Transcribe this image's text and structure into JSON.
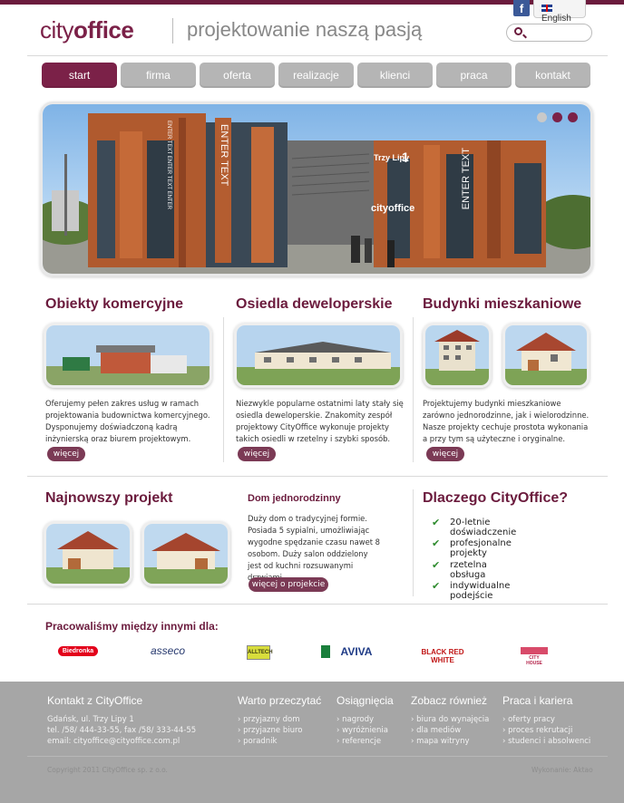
{
  "header": {
    "logo_a": "city",
    "logo_b": "office",
    "tagline": "projektowanie naszą pasją",
    "facebook_label": "f",
    "lang_label": "English",
    "search_placeholder": ""
  },
  "nav": [
    "start",
    "firma",
    "oferta",
    "realizacje",
    "klienci",
    "praca",
    "kontakt"
  ],
  "nav_active": "start",
  "hero": {
    "sign_trzy": "Trzy Lipy",
    "sign_num": "1",
    "sign_brand": "cityoffice",
    "banner_text": "ENTER TEXT",
    "banner_text_small": "ENTER TEXT ENTER TEXT ENTER"
  },
  "columns": [
    {
      "title": "Obiekty komercyjne",
      "text": "Oferujemy pełen zakres usług w ramach projektowania budownictwa komercyjnego. Dysponujemy doświadczoną kadrą inżynierską oraz biurem projektowym.",
      "button": "więcej"
    },
    {
      "title": "Osiedla deweloperskie",
      "text": "Niezwykle popularne ostatnimi laty stały się osiedla deweloperskie. Znakomity zespół projektowy CityOffice wykonuje projekty takich osiedli w rzetelny i szybki sposób.",
      "button": "więcej"
    },
    {
      "title": "Budynki mieszkaniowe",
      "text": "Projektujemy budynki mieszkaniowe zarówno jednorodzinne, jak i wielorodzinne. Nasze projekty cechuje prostota wykonania a przy tym są użyteczne i oryginalne.",
      "button": "więcej"
    }
  ],
  "newest": {
    "title": "Najnowszy projekt",
    "subtitle": "Dom jednorodzinny",
    "text": "Duży dom o tradycyjnej formie. Posiada 5 sypialni, umożliwiając wygodne spędzanie czasu nawet 8 osobom. Duży salon oddzielony jest od kuchni rozsuwanymi drzwiami.",
    "button": "więcej o projekcie"
  },
  "why": {
    "title": "Dlaczego CityOffice?",
    "items": [
      "20-letnie doświadczenie",
      "profesjonalne projekty",
      "rzetelna obsługa",
      "indywidualne podejście"
    ]
  },
  "clients": {
    "title": "Pracowaliśmy między innymi dla:",
    "logos": [
      "Biedronka",
      "asseco",
      "ALLTECH",
      "AVIVA",
      "BLACK RED WHITE",
      "CITY HOUSE"
    ]
  },
  "footer": {
    "contact_title": "Kontakt z CityOffice",
    "contact_lines": [
      "Gdańsk, ul. Trzy Lipy 1",
      "tel. /58/ 444-33-55, fax /58/ 333-44-55",
      "email: cityoffice@cityoffice.com.pl"
    ],
    "col2_title": "Warto przeczytać",
    "col2_links": [
      "przyjazny dom",
      "przyjazne biuro",
      "poradnik"
    ],
    "col3_title": "Osiągnięcia",
    "col3_links": [
      "nagrody",
      "wyróżnienia",
      "referencje"
    ],
    "col4_title": "Zobacz również",
    "col4_links": [
      "biura do wynajęcia",
      "dla mediów",
      "mapa witryny"
    ],
    "col5_title": "Praca i kariera",
    "col5_links": [
      "oferty pracy",
      "proces rekrutacji",
      "studenci i absolwenci"
    ],
    "copyright": "Copyright 2011 CityOffice sp. z o.o.",
    "made_by": "Wykonanie: Aktao"
  },
  "colors": {
    "brand": "#6b1b3d",
    "nav_inactive": "#b5b5b5",
    "footer": "#a6a6a6"
  }
}
